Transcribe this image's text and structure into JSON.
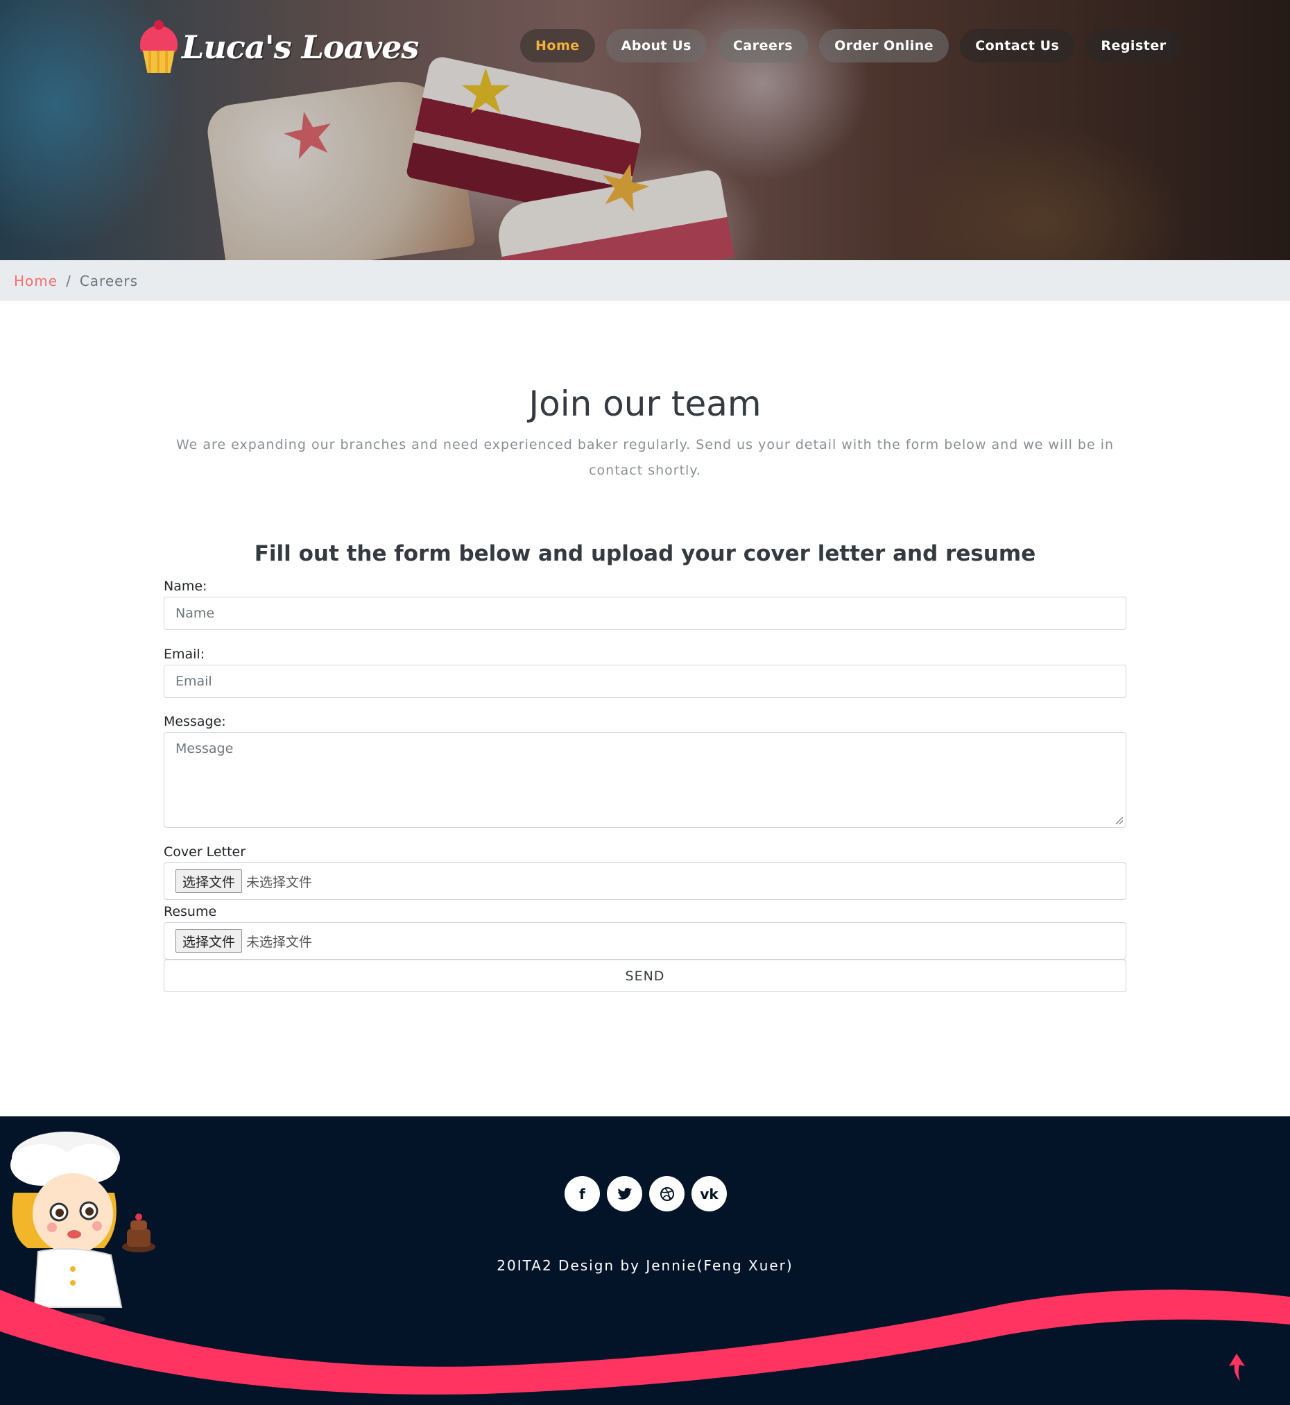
{
  "brand": {
    "name": "Luca's Loaves"
  },
  "nav": {
    "items": [
      {
        "label": "Home",
        "active": true
      },
      {
        "label": "About Us",
        "active": false
      },
      {
        "label": "Careers",
        "active": false
      },
      {
        "label": "Order Online",
        "active": false
      },
      {
        "label": "Contact Us",
        "active": false
      },
      {
        "label": "Register",
        "active": false
      }
    ]
  },
  "breadcrumb": {
    "home": "Home",
    "separator": "/",
    "current": "Careers"
  },
  "main": {
    "title": "Join our team",
    "intro": "We are expanding our branches and need experienced baker regularly. Send us your detail with the form below and we will be in contact shortly.",
    "form_heading": "Fill out the form below and upload your cover letter and resume"
  },
  "form": {
    "name": {
      "label": "Name:",
      "placeholder": "Name"
    },
    "email": {
      "label": "Email:",
      "placeholder": "Email"
    },
    "message": {
      "label": "Message:",
      "placeholder": "Message"
    },
    "cover_letter": {
      "label": "Cover Letter",
      "button": "选择文件",
      "status": "未选择文件"
    },
    "resume": {
      "label": "Resume",
      "button": "选择文件",
      "status": "未选择文件"
    },
    "send_label": "SEND"
  },
  "footer": {
    "socials": [
      {
        "icon": "facebook-icon",
        "glyph": "f"
      },
      {
        "icon": "twitter-icon",
        "glyph": "🐦"
      },
      {
        "icon": "dribbble-icon",
        "glyph": "⚽"
      },
      {
        "icon": "vk-icon",
        "glyph": "vk"
      }
    ],
    "credit": "20ITA2 Design by Jennie(Feng Xuer)"
  },
  "colors": {
    "accent": "#f3b23c",
    "breadcrumb_link": "#f2706f",
    "footer_bg": "#041428",
    "wave": "#ff3461"
  }
}
